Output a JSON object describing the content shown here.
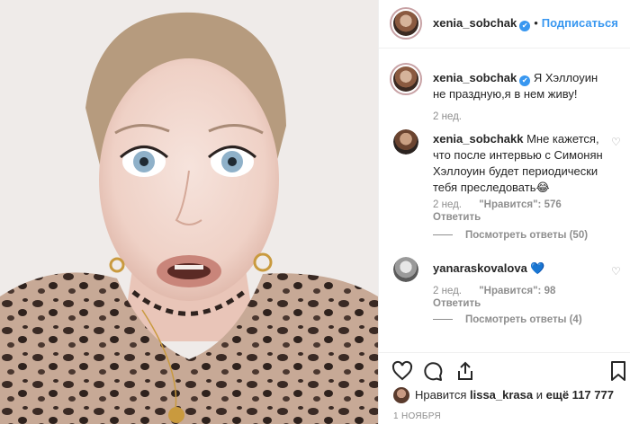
{
  "post": {
    "author": "xenia_sobchak",
    "follow_label": "Подписаться",
    "dot": "•",
    "caption": "Я Хэллоуин не праздную,я в нем живу!",
    "caption_time": "2 нед.",
    "verified_symbol": "✔"
  },
  "comments": [
    {
      "user": "xenia_sobchakk",
      "text": "Мне кажется, что после интервью с Симонян Хэллоуин будет периодически тебя преследовать😂",
      "time": "2 нед.",
      "likes": "\"Нравится\": 576",
      "reply_label": "Ответить",
      "view_replies": "Посмотреть ответы (50)"
    },
    {
      "user": "yanaraskovalova",
      "text": "💙",
      "time": "2 нед.",
      "likes": "\"Нравится\": 98",
      "reply_label": "Ответить",
      "view_replies": "Посмотреть ответы (4)"
    }
  ],
  "footer": {
    "liked_by_prefix": "Нравится",
    "liked_by_user": "lissa_krasa",
    "liked_by_suffix": "и",
    "liked_by_more": "ещё 117 777",
    "date": "1 НОЯБРЯ"
  },
  "icons": {
    "like": "heart-icon",
    "comment": "comment-icon",
    "share": "share-icon",
    "save": "bookmark-icon",
    "comment_like": "heart-icon"
  },
  "colors": {
    "link_blue": "#3897f0",
    "text": "#262626",
    "muted": "#8e8e8e",
    "border": "#efefef"
  }
}
